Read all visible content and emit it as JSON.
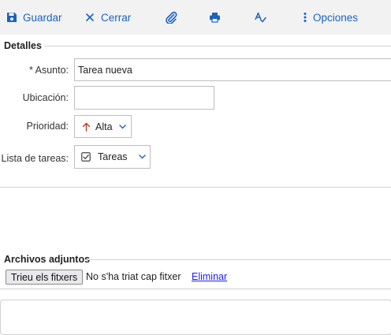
{
  "toolbar": {
    "save": {
      "label": "Guardar",
      "icon": "floppy-icon"
    },
    "close": {
      "label": "Cerrar",
      "icon": "close-icon"
    },
    "attach": {
      "icon": "paperclip-icon"
    },
    "print": {
      "icon": "printer-icon"
    },
    "spell": {
      "icon": "spellcheck-icon"
    },
    "options": {
      "label": "Opciones",
      "icon": "kebab-icon"
    }
  },
  "details": {
    "title": "Detalles",
    "subject": {
      "label": "* Asunto:",
      "value": "Tarea nueva"
    },
    "location": {
      "label": "Ubicación:",
      "value": ""
    },
    "priority": {
      "label": "Prioridad:",
      "value": "Alta",
      "icon": "arrow-up-icon"
    },
    "tasklist": {
      "label": "Lista de tareas:",
      "value": "Tareas",
      "icon": "checkbox-icon"
    }
  },
  "attachments": {
    "title": "Archivos adjuntos",
    "choose_button": "Trieu els fitxers",
    "no_file_text": "No s'ha triat cap fitxer",
    "remove_link": "Eliminar"
  },
  "colors": {
    "accent": "#1a63c0",
    "priority_high": "#c0392b",
    "toolbar_bg": "#f2f2f2",
    "link": "#1a1aff"
  }
}
